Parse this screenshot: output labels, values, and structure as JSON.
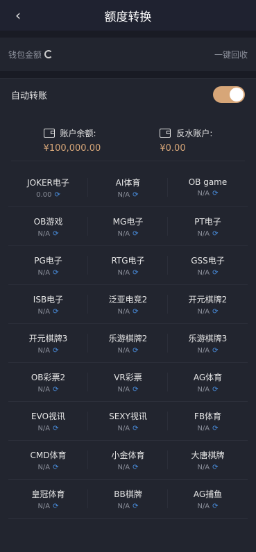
{
  "header": {
    "title": "额度转换"
  },
  "wallet": {
    "label": "钱包金额",
    "recycle": "一键回收"
  },
  "auto_transfer": {
    "label": "自动转账",
    "enabled": true
  },
  "balances": {
    "account": {
      "label": "账户余额:",
      "amount": "¥100,000.00"
    },
    "rebate": {
      "label": "反水账户:",
      "amount": "¥0.00"
    }
  },
  "games": [
    {
      "name": "JOKER电子",
      "value": "0.00"
    },
    {
      "name": "AI体育",
      "value": "N/A"
    },
    {
      "name": "OB game",
      "value": "N/A"
    },
    {
      "name": "OB游戏",
      "value": "N/A"
    },
    {
      "name": "MG电子",
      "value": "N/A"
    },
    {
      "name": "PT电子",
      "value": "N/A"
    },
    {
      "name": "PG电子",
      "value": "N/A"
    },
    {
      "name": "RTG电子",
      "value": "N/A"
    },
    {
      "name": "GSS电子",
      "value": "N/A"
    },
    {
      "name": "ISB电子",
      "value": "N/A"
    },
    {
      "name": "泛亚电竞2",
      "value": "N/A"
    },
    {
      "name": "开元棋牌2",
      "value": "N/A"
    },
    {
      "name": "开元棋牌3",
      "value": "N/A"
    },
    {
      "name": "乐游棋牌2",
      "value": "N/A"
    },
    {
      "name": "乐游棋牌3",
      "value": "N/A"
    },
    {
      "name": "OB彩票2",
      "value": "N/A"
    },
    {
      "name": "VR彩票",
      "value": "N/A"
    },
    {
      "name": "AG体育",
      "value": "N/A"
    },
    {
      "name": "EVO视讯",
      "value": "N/A"
    },
    {
      "name": "SEXY视讯",
      "value": "N/A"
    },
    {
      "name": "FB体育",
      "value": "N/A"
    },
    {
      "name": "CMD体育",
      "value": "N/A"
    },
    {
      "name": "小金体育",
      "value": "N/A"
    },
    {
      "name": "大唐棋牌",
      "value": "N/A"
    },
    {
      "name": "皇冠体育",
      "value": "N/A"
    },
    {
      "name": "BB棋牌",
      "value": "N/A"
    },
    {
      "name": "AG捕鱼",
      "value": "N/A"
    }
  ],
  "icons": {
    "back": "chevron-left-icon",
    "refresh": "refresh-icon",
    "sync": "sync-icon",
    "wallet": "wallet-icon"
  },
  "colors": {
    "accent": "#d7a678",
    "sync": "#4a90e2"
  }
}
